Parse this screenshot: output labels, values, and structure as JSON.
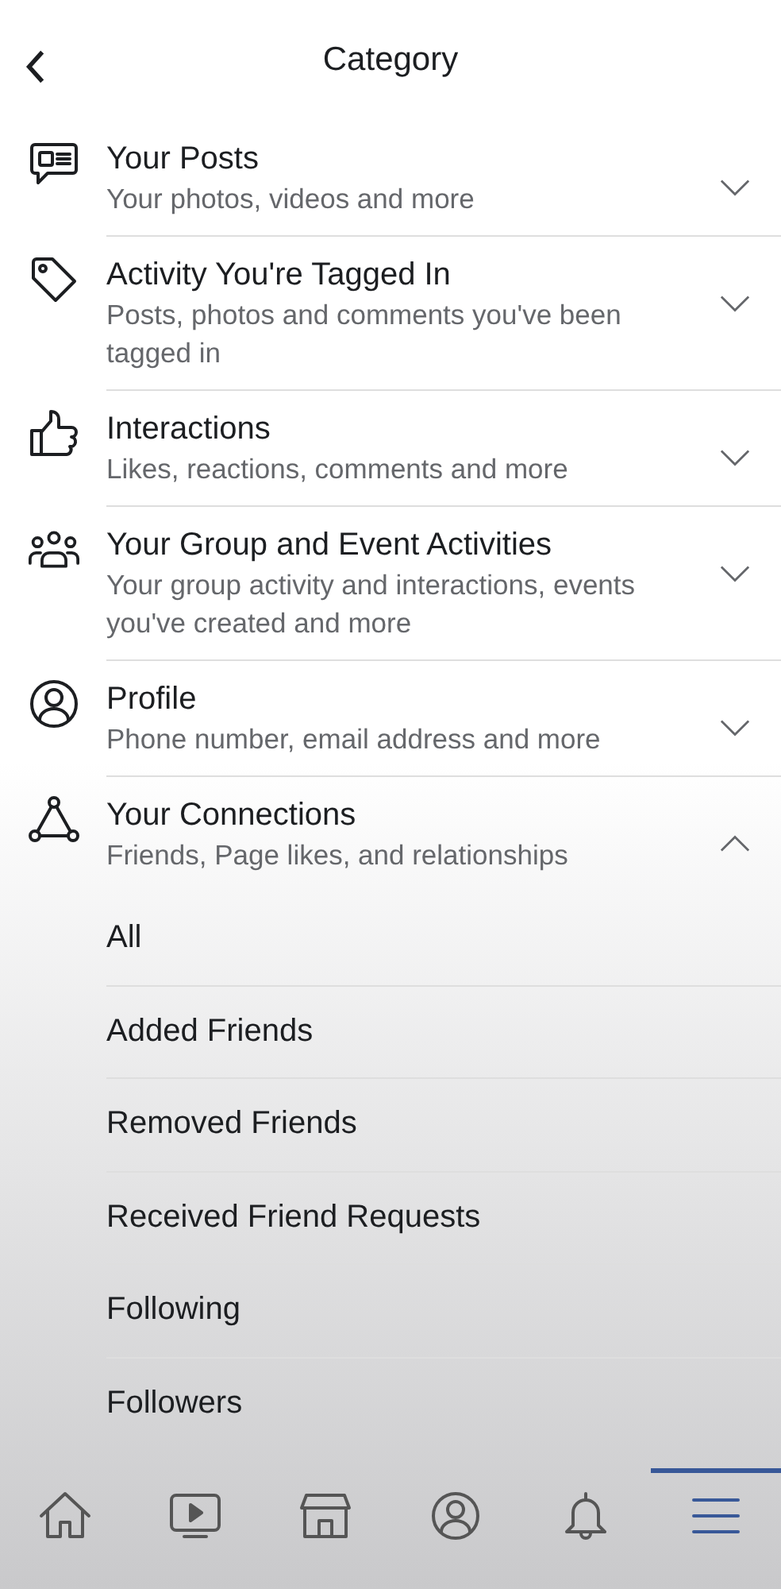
{
  "header": {
    "title": "Category"
  },
  "categories": [
    {
      "kind": "posts",
      "title": "Your Posts",
      "subtitle": "Your photos, videos and more",
      "expanded": false
    },
    {
      "kind": "tag",
      "title": "Activity You're Tagged In",
      "subtitle": "Posts, photos and comments you've been tagged in",
      "expanded": false
    },
    {
      "kind": "like",
      "title": "Interactions",
      "subtitle": "Likes, reactions, comments and more",
      "expanded": false
    },
    {
      "kind": "group",
      "title": "Your Group and Event Activities",
      "subtitle": "Your group activity and interactions, events you've created and more",
      "expanded": false
    },
    {
      "kind": "profile",
      "title": "Profile",
      "subtitle": "Phone number, email address and more",
      "expanded": false
    },
    {
      "kind": "connections",
      "title": "Your Connections",
      "subtitle": "Friends, Page likes, and relationships",
      "expanded": true,
      "children": [
        "All",
        "Added Friends",
        "Removed Friends",
        "Received Friend Requests",
        "Following",
        "Followers"
      ]
    }
  ],
  "tab_bar": [
    {
      "kind": "home",
      "selected": false
    },
    {
      "kind": "video",
      "selected": false
    },
    {
      "kind": "marketplace",
      "selected": false
    },
    {
      "kind": "profile",
      "selected": false
    },
    {
      "kind": "bell",
      "selected": false
    },
    {
      "kind": "menu",
      "selected": true
    }
  ]
}
